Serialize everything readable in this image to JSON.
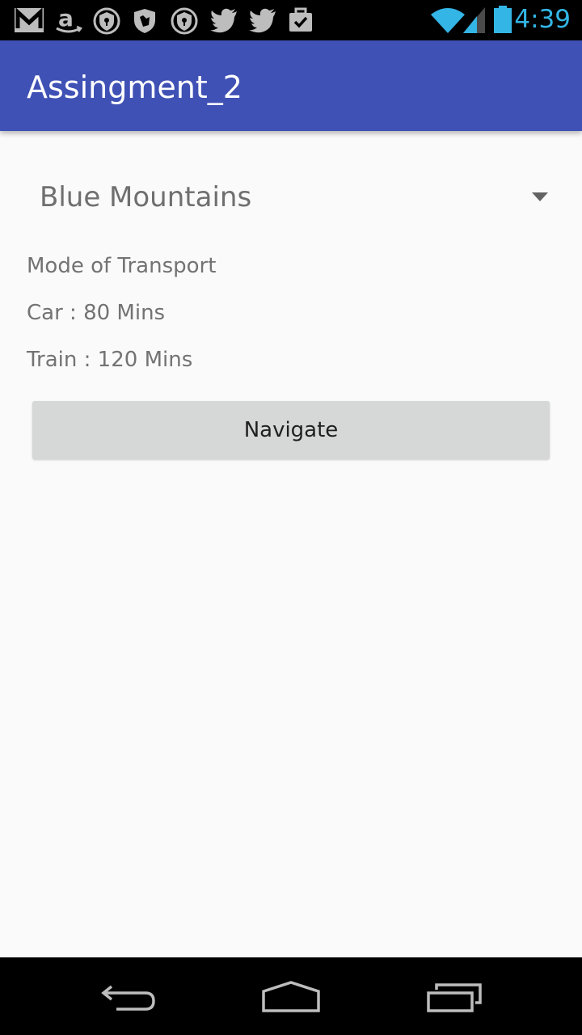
{
  "status_bar": {
    "time": "4:39",
    "notification_icons": [
      "gmail-icon",
      "amazon-icon",
      "vpn-shield-icon",
      "hand-shield-icon",
      "vpn-shield-icon",
      "twitter-icon",
      "twitter-icon",
      "briefcase-check-icon"
    ],
    "system_icons": [
      "wifi-icon",
      "cell-signal-icon",
      "battery-icon"
    ],
    "time_color": "#33b5e5"
  },
  "app_bar": {
    "title": "Assingment_2",
    "color": "#3f51b5"
  },
  "spinner": {
    "selected": "Blue Mountains"
  },
  "transport": {
    "heading": "Mode of Transport",
    "car": "Car : 80 Mins",
    "train": "Train : 120 Mins"
  },
  "actions": {
    "navigate_label": "Navigate"
  },
  "nav_bar": {
    "keys": [
      "back-icon",
      "home-icon",
      "recent-apps-icon"
    ]
  }
}
